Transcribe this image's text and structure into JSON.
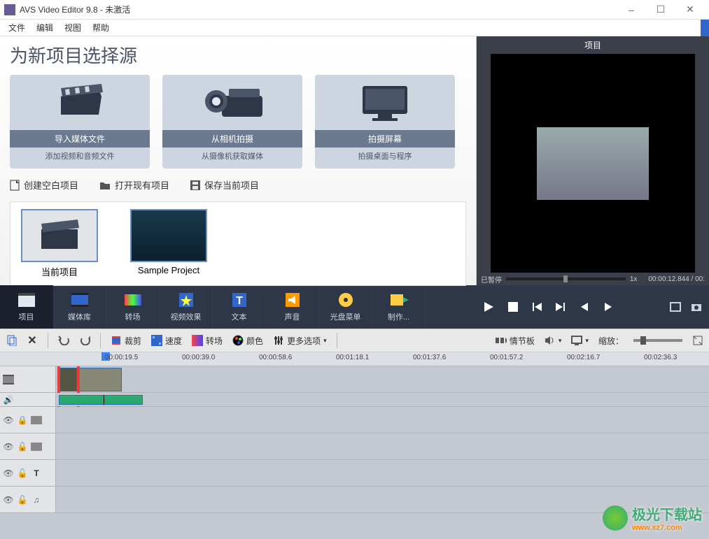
{
  "title": "AVS Video Editor 9.8 - 未激活",
  "window_controls": {
    "min": "–",
    "max": "☐",
    "close": "✕"
  },
  "menu": [
    "文件",
    "编辑",
    "视图",
    "帮助"
  ],
  "source_header": "为新项目选择源",
  "sources": [
    {
      "title": "导入媒体文件",
      "sub": "添加视频和音频文件"
    },
    {
      "title": "从相机拍摄",
      "sub": "从摄像机获取媒体"
    },
    {
      "title": "拍摄屏幕",
      "sub": "拍摄桌面与程序"
    }
  ],
  "project_actions": [
    "创建空白项目",
    "打开现有项目",
    "保存当前项目"
  ],
  "projects": [
    "当前项目",
    "Sample Project"
  ],
  "preview": {
    "title": "项目",
    "status": "已暂停",
    "speed": "1x",
    "time": "00:00:12.844 / 00:"
  },
  "tabs": [
    "项目",
    "媒体库",
    "转场",
    "视频效果",
    "文本",
    "声音",
    "光盘菜单",
    "制作..."
  ],
  "edit_tools": {
    "crop": "裁剪",
    "speed": "速度",
    "transition": "转场",
    "color": "颜色",
    "more": "更多选项",
    "storyboard": "情节板",
    "zoom_label": "缩放："
  },
  "ruler": [
    "00:00:19.5",
    "00:00:39.0",
    "00:00:58.6",
    "00:01:18.1",
    "00:01:37.6",
    "00:01:57.2",
    "00:02:16.7",
    "00:02:36.3"
  ],
  "watermark": {
    "title": "极光下载站",
    "url": "www.xz7.com"
  }
}
